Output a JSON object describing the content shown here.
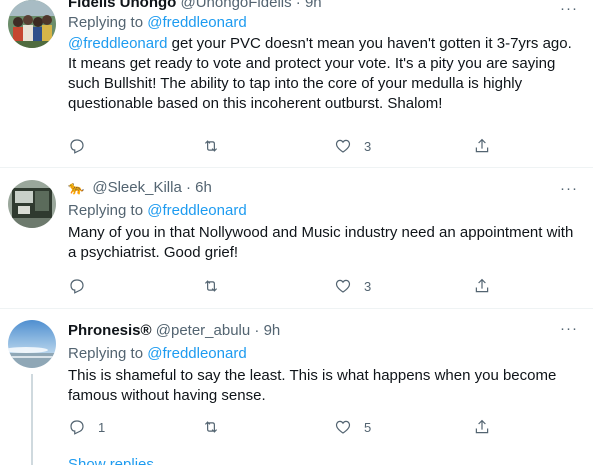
{
  "tweets": [
    {
      "name": "Fidelis Unongo",
      "handle": "@UnongoFidelis",
      "time": "9h",
      "replying_prefix": "Replying to",
      "replying_to": "@freddleonard",
      "text_mention": "@freddleonard",
      "text": " get your PVC doesn't mean you haven't gotten it 3-7yrs ago. It means get ready to vote and protect your vote. It's a pity you are saying such Bullshit! The ability to tap into the core of your medulla is highly questionable based on this incoherent outburst. Shalom!",
      "replies": "",
      "likes": "3"
    },
    {
      "name_emoji": "🐆",
      "name": "",
      "handle": "@Sleek_Killa",
      "time": "6h",
      "replying_prefix": "Replying to",
      "replying_to": "@freddleonard",
      "text": "Many of you in that Nollywood and Music industry need an appointment with a psychiatrist. Good grief!",
      "replies": "",
      "likes": "3"
    },
    {
      "name": "Phronesis®",
      "handle": "@peter_abulu",
      "time": "9h",
      "replying_prefix": "Replying to",
      "replying_to": "@freddleonard",
      "text": "This is shameful to say the least. This is what happens when you become famous without having sense.",
      "replies": "1",
      "likes": "5"
    }
  ],
  "dot": "·",
  "more_label": "···",
  "show_replies": "Show replies",
  "colors": {
    "accent": "#1d9bf0",
    "muted": "#536471",
    "text": "#0f1419",
    "divider": "#eff3f4"
  },
  "icons": [
    "reply-icon",
    "retweet-icon",
    "like-icon",
    "share-icon",
    "more-icon"
  ]
}
